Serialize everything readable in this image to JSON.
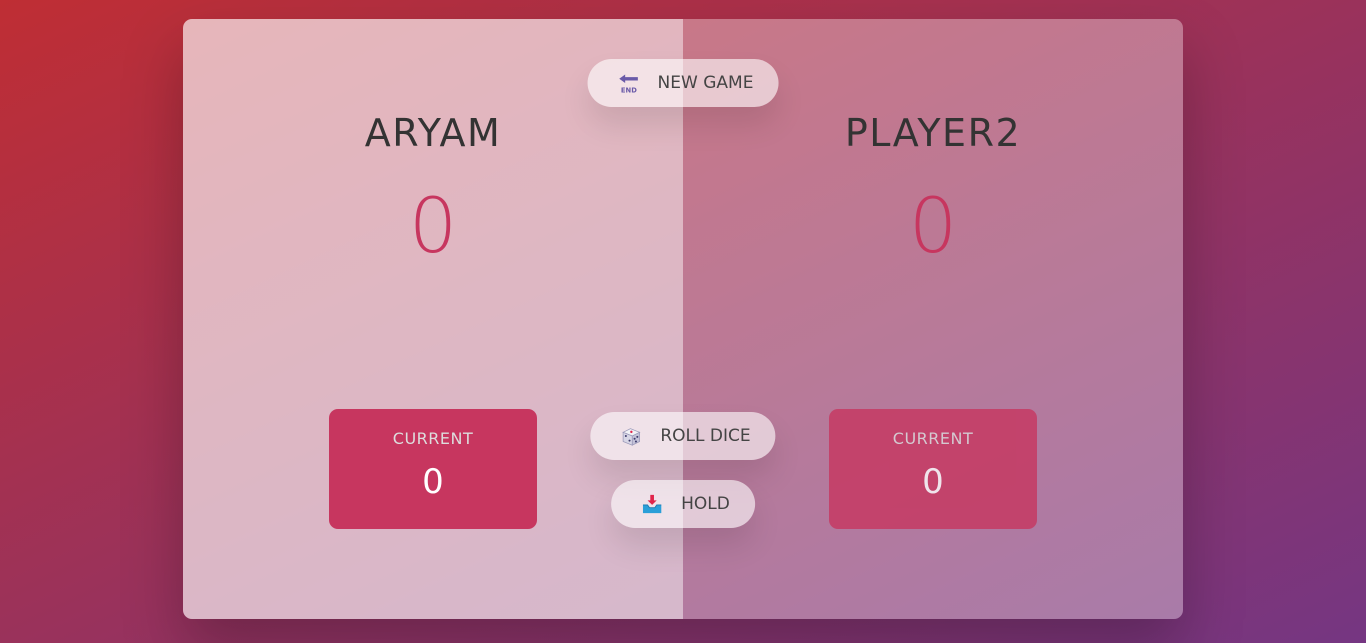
{
  "buttons": {
    "new_game": {
      "label": "NEW GAME",
      "icon": "end-arrow-icon"
    },
    "roll_dice": {
      "label": "ROLL DICE",
      "icon": "dice-icon"
    },
    "hold": {
      "label": "HOLD",
      "icon": "inbox-tray-icon"
    }
  },
  "players": [
    {
      "name": "ARYAM",
      "score": "0",
      "current_label": "CURRENT",
      "current_score": "0",
      "active": true
    },
    {
      "name": "PLAYER2",
      "score": "0",
      "current_label": "CURRENT",
      "current_score": "0",
      "active": false
    }
  ],
  "colors": {
    "accent": "#c7365f",
    "gradient_start": "#bf2e34",
    "gradient_end": "#753682"
  }
}
